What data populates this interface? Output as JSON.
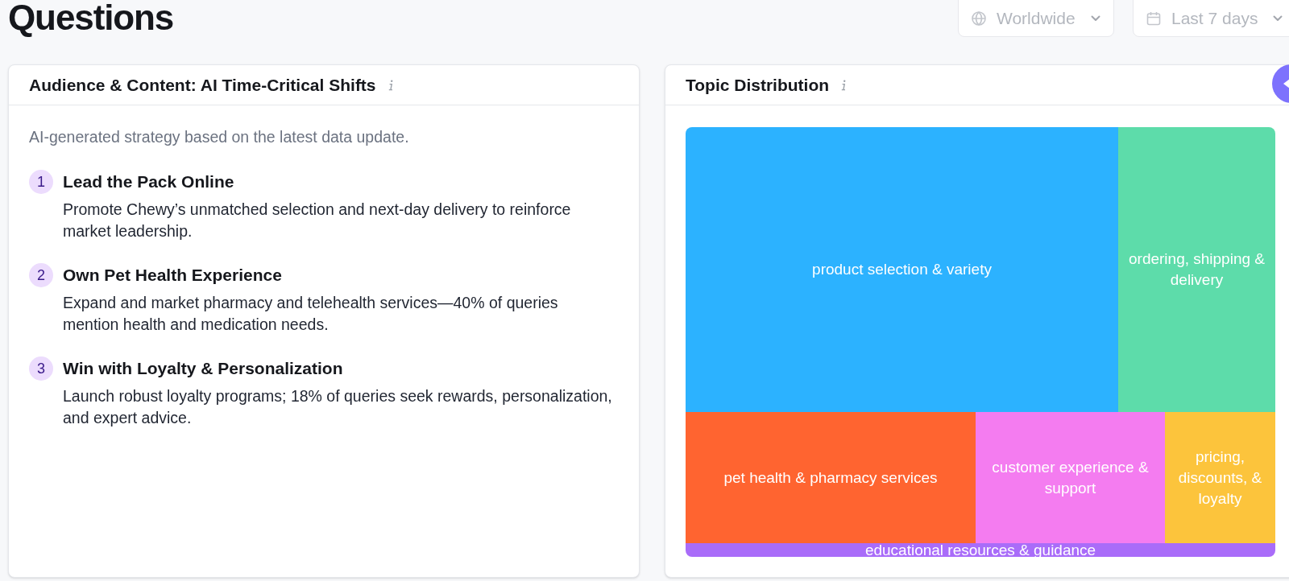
{
  "page": {
    "title": "Questions"
  },
  "filters": [
    {
      "kind": "location",
      "label": "Worldwide"
    },
    {
      "kind": "date",
      "label": "Last 7 days"
    }
  ],
  "strategy_card": {
    "title": "Audience & Content: AI Time-Critical Shifts",
    "intro": "AI-generated strategy based on the latest data update.",
    "items": [
      {
        "number": "1",
        "title": "Lead the Pack Online",
        "description": "Promote Chewy’s unmatched selection and next-day delivery to reinforce market leadership."
      },
      {
        "number": "2",
        "title": "Own Pet Health Experience",
        "description": "Expand and market pharmacy and telehealth services—40% of queries mention health and medication needs."
      },
      {
        "number": "3",
        "title": "Win with Loyalty & Personalization",
        "description": "Launch robust loyalty programs; 18% of queries seek rewards, personalization, and expert advice."
      }
    ]
  },
  "topic_card": {
    "title": "Topic Distribution",
    "treemap": {
      "rows": [
        {
          "tiles": [
            {
              "label": "product selection & variety",
              "color": "#2cb2ff"
            },
            {
              "label": "ordering, shipping & delivery",
              "color": "#5ddcaa"
            }
          ]
        },
        {
          "tiles": [
            {
              "label": "pet health & pharmacy services",
              "color": "#ff6430"
            },
            {
              "label": "customer experience & support",
              "color": "#f47cf0"
            },
            {
              "label": "pricing, discounts, & loyalty",
              "color": "#fcc43c"
            }
          ]
        },
        {
          "tiles": [
            {
              "label": "educational resources & guidance",
              "color": "#a96cf9"
            }
          ]
        }
      ]
    }
  }
}
